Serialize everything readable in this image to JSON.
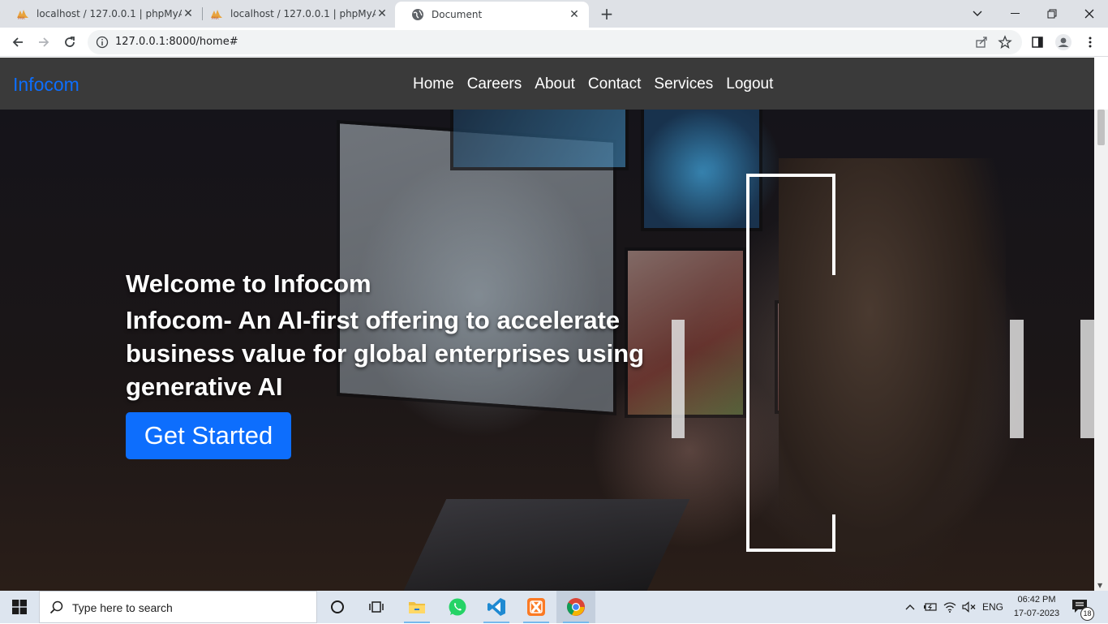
{
  "browser": {
    "tabs": [
      {
        "title": "localhost / 127.0.0.1 | phpMyAdmin",
        "favicon": "phpmyadmin-icon",
        "active": false
      },
      {
        "title": "localhost / 127.0.0.1 | phpMyAdmin",
        "favicon": "phpmyadmin-icon",
        "active": false
      },
      {
        "title": "Document",
        "favicon": "globe-icon",
        "active": true
      }
    ],
    "url": "127.0.0.1:8000/home#"
  },
  "site": {
    "brand": "Infocom",
    "nav": [
      "Home",
      "Careers",
      "About",
      "Contact",
      "Services",
      "Logout"
    ],
    "hero": {
      "welcome": "Welcome to Infocom",
      "tagline": "Infocom- An AI-first offering to accelerate business value for global enterprises using generative AI",
      "cta": "Get Started"
    },
    "colors": {
      "brand": "#0d6efd",
      "nav_bg": "#3a3a3a",
      "cta_bg": "#0d6efd"
    }
  },
  "taskbar": {
    "search_placeholder": "Type here to search",
    "apps": [
      "cortana-icon",
      "task-view-icon",
      "file-explorer-icon",
      "whatsapp-icon",
      "vscode-icon",
      "xampp-icon",
      "chrome-icon"
    ],
    "language": "ENG",
    "time": "06:42 PM",
    "date": "17-07-2023",
    "notification_count": "18"
  }
}
